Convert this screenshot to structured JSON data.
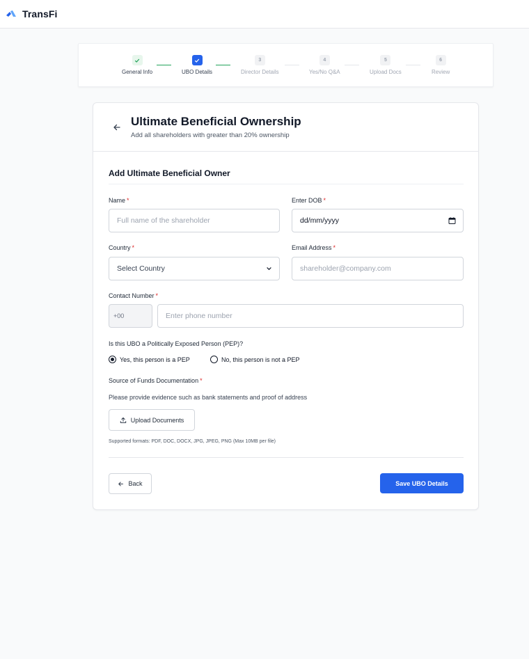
{
  "app": {
    "brand": "TransFi",
    "brand_color": "#2563eb",
    "logo_icon": "transfi-logo"
  },
  "stepper": {
    "steps": [
      {
        "label": "General Info",
        "number": "",
        "status": "done",
        "icon": "check-icon"
      },
      {
        "label": "UBO Details",
        "number": "",
        "status": "active",
        "icon": "check-icon"
      },
      {
        "label": "Director Details",
        "number": "3",
        "status": "pending"
      },
      {
        "label": "Yes/No Q&A",
        "number": "4",
        "status": "pending"
      },
      {
        "label": "Upload Docs",
        "number": "5",
        "status": "pending"
      },
      {
        "label": "Review",
        "number": "6",
        "status": "pending"
      }
    ],
    "colors": {
      "done": "#22a35a",
      "active": "#2563eb",
      "pending": "#a1a7b3"
    }
  },
  "header": {
    "title": "Ultimate Beneficial Ownership",
    "subtitle": "Add all shareholders with greater than 20% ownership",
    "back_icon": "arrow-left-icon"
  },
  "form": {
    "section_title": "Add Ultimate Beneficial Owner",
    "required_mark": "*",
    "name": {
      "label": "Name",
      "placeholder": "Full name of the shareholder",
      "value": ""
    },
    "dob": {
      "label": "Enter DOB",
      "value": "dd/mm/yyyy",
      "icon": "calendar-icon"
    },
    "country": {
      "label": "Country",
      "selected": "Select Country",
      "icon": "chevron-down-icon"
    },
    "email": {
      "label": "Email Address",
      "placeholder": "shareholder@company.com",
      "value": ""
    },
    "contact": {
      "label": "Contact Number",
      "code": "+00",
      "placeholder": "Enter phone number",
      "value": ""
    },
    "pep": {
      "question": "Is this UBO a Politically Exposed Person (PEP)?",
      "options": [
        {
          "label": "Yes, this person is a PEP",
          "checked": true
        },
        {
          "label": "No, this person is not a PEP",
          "checked": false
        }
      ]
    },
    "funds": {
      "label": "Source of Funds Documentation",
      "help": "Please provide evidence such as bank statements and proof of address",
      "upload_label": "Upload Documents",
      "upload_icon": "upload-icon",
      "formats": "Supported formats: PDF, DOC, DOCX, JPG, JPEG, PNG (Max 10MB per file)"
    }
  },
  "footer": {
    "back_label": "Back",
    "back_icon": "arrow-left-icon",
    "save_label": "Save UBO Details"
  }
}
